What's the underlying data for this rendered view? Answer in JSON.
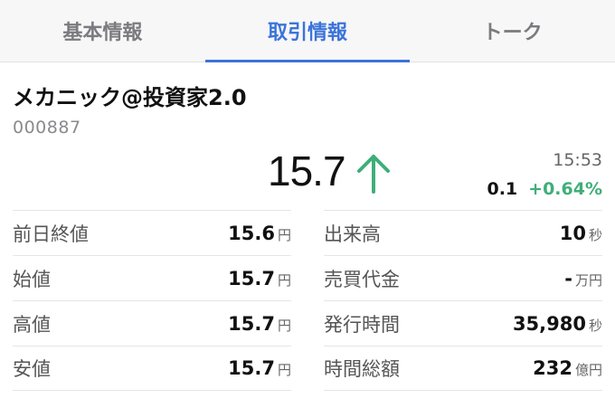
{
  "tabs": [
    {
      "label": "基本情報",
      "active": false
    },
    {
      "label": "取引情報",
      "active": true
    },
    {
      "label": "トーク",
      "active": false
    }
  ],
  "stock": {
    "name": "メカニック@投資家2.0",
    "code": "000887",
    "price": "15.7",
    "direction_icon": "arrow-up-icon",
    "time": "15:53",
    "change_abs": "0.1",
    "change_pct": "+0.64%"
  },
  "colors": {
    "accent": "#3b74d9",
    "up": "#3fae79"
  },
  "left_stats": [
    {
      "label": "前日終値",
      "value": "15.6",
      "unit": "円"
    },
    {
      "label": "始値",
      "value": "15.7",
      "unit": "円"
    },
    {
      "label": "高値",
      "value": "15.7",
      "unit": "円"
    },
    {
      "label": "安値",
      "value": "15.7",
      "unit": "円"
    }
  ],
  "right_stats": [
    {
      "label": "出来高",
      "value": "10",
      "unit": "秒"
    },
    {
      "label": "売買代金",
      "value": "-",
      "unit": "万円"
    },
    {
      "label": "発行時間",
      "value": "35,980",
      "unit": "秒"
    },
    {
      "label": "時間総額",
      "value": "232",
      "unit": "億円"
    }
  ]
}
